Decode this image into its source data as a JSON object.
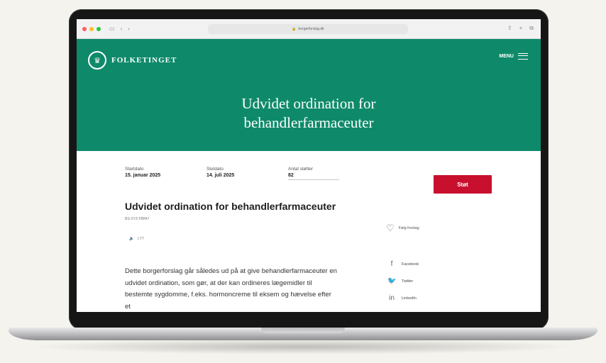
{
  "browser": {
    "url": "borgerforslag.dk",
    "traffic_colors": [
      "#ff5f57",
      "#febc2e",
      "#28c840"
    ]
  },
  "header": {
    "brand": "FOLKETINGET",
    "menu_label": "MENU",
    "title_line1": "Udvidet ordination for",
    "title_line2": "behandlerfarmaceuter",
    "color": "#0e8a6a"
  },
  "meta": {
    "start_label": "Startdato",
    "start_value": "15. januar 2025",
    "end_label": "Slutdato",
    "end_value": "14. juli 2025",
    "count_label": "Antal støtter",
    "count_value": "82"
  },
  "cta": {
    "label": "Støt",
    "color": "#c8102e"
  },
  "article": {
    "title": "Udvidet ordination for behandlerfarmaceuter",
    "id": "BS-XYZ-FB847",
    "listen_label": "LYT",
    "body": "Dette borgerforslag går således ud på at give behandlerfarmaceuter en udvidet ordination, som gør, at der kan ordineres lægemidler til bestemte sygdomme, f.eks. hormoncreme til eksem og hævelse efter et"
  },
  "sidebar": {
    "follow_label": "Følg forslag",
    "share": [
      {
        "icon": "facebook-icon",
        "label": "Facebook"
      },
      {
        "icon": "twitter-icon",
        "label": "Twitter"
      },
      {
        "icon": "linkedin-icon",
        "label": "LinkedIn"
      }
    ]
  }
}
